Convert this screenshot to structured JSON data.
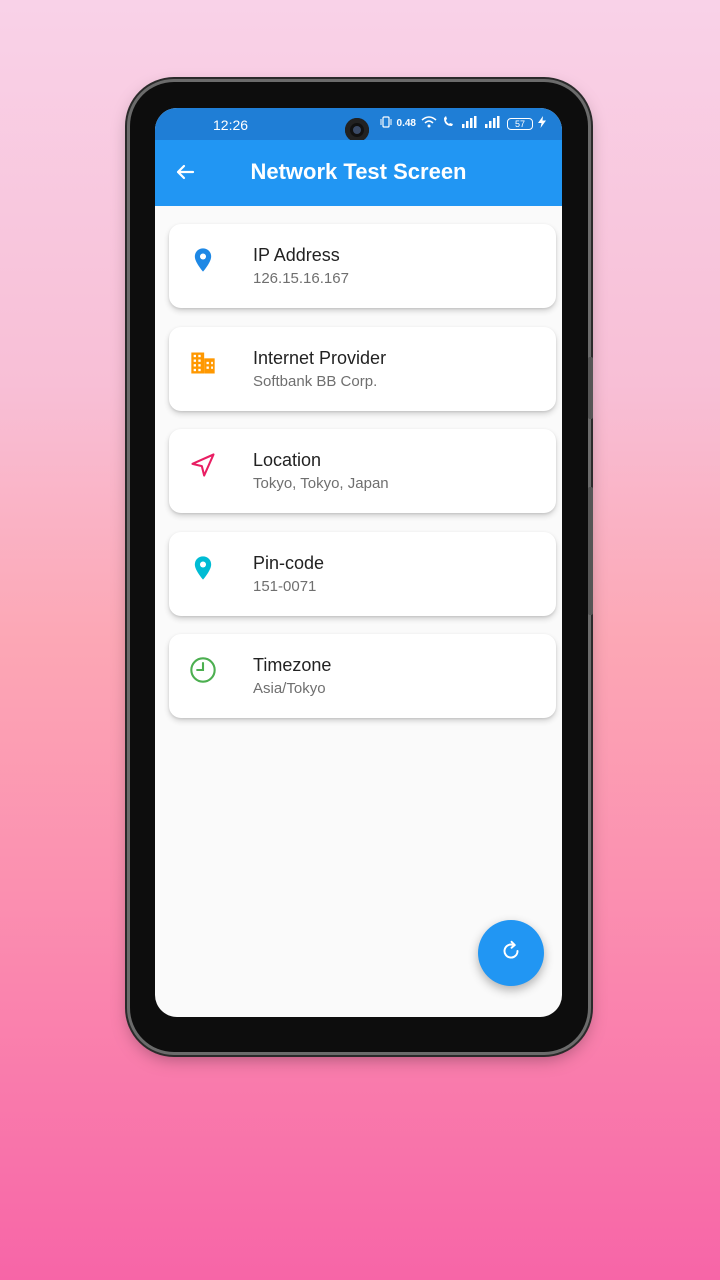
{
  "status_bar": {
    "time": "12:26",
    "net_speed": "0.48",
    "battery": "57"
  },
  "app_bar": {
    "title": "Network Test Screen",
    "back_icon": "arrow-left-icon"
  },
  "cards": [
    {
      "label": "IP Address",
      "value": "126.15.16.167",
      "icon": "location-pin-icon",
      "color": "#1e88e5"
    },
    {
      "label": "Internet Provider",
      "value": "Softbank BB Corp.",
      "icon": "building-icon",
      "color": "#ff9800"
    },
    {
      "label": "Location",
      "value": "Tokyo, Tokyo, Japan",
      "icon": "navigation-arrow-icon",
      "color": "#e91e63"
    },
    {
      "label": "Pin-code",
      "value": "151-0071",
      "icon": "location-pin-icon",
      "color": "#00bcd4"
    },
    {
      "label": "Timezone",
      "value": "Asia/Tokyo",
      "icon": "clock-icon",
      "color": "#4caf50"
    }
  ],
  "fab": {
    "icon": "refresh-icon"
  },
  "colors": {
    "app_bar": "#2196f3",
    "status_bar": "#1f7ed6"
  }
}
